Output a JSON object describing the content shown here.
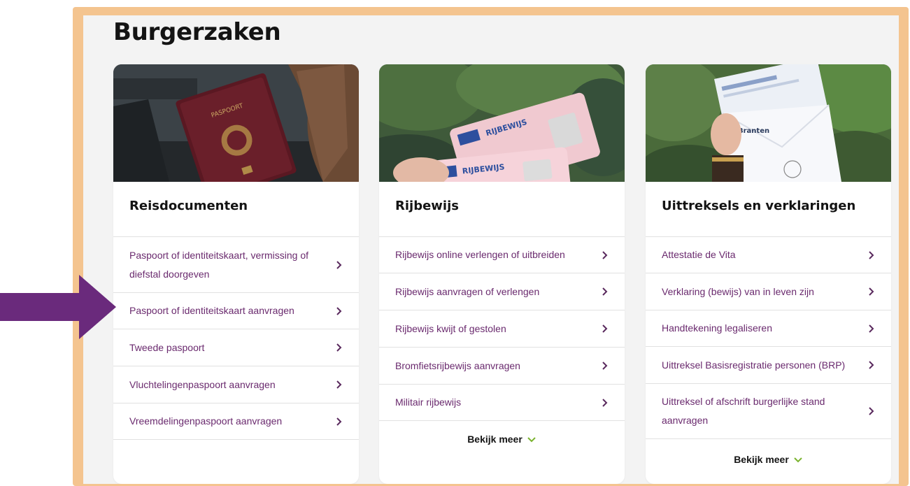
{
  "page": {
    "title": "Burgerzaken"
  },
  "colors": {
    "frame": "#f4c48f",
    "link": "#6a2a6e",
    "chevron": "#5a2a5e",
    "accent_green": "#7ab32e",
    "arrow": "#6a2a7c"
  },
  "cards": [
    {
      "title": "Reisdocumenten",
      "items": [
        "Paspoort of identiteitskaart, vermissing of diefstal doorgeven",
        "Paspoort of identiteitskaart aanvragen",
        "Tweede paspoort",
        "Vluchtelingenpaspoort aanvragen",
        "Vreemdelingenpaspoort aanvragen"
      ]
    },
    {
      "title": "Rijbewijs",
      "items": [
        "Rijbewijs online verlengen of uitbreiden",
        "Rijbewijs aanvragen of verlengen",
        "Rijbewijs kwijt of gestolen",
        "Bromfietsrijbewijs aanvragen",
        "Militair rijbewijs"
      ],
      "more": "Bekijk meer",
      "img_text": [
        "RIJBEWIJS",
        "RIJBEWIJS"
      ]
    },
    {
      "title": "Uittreksels en verklaringen",
      "items": [
        "Attestatie de Vita",
        "Verklaring (bewijs) van in leven zijn",
        "Handtekening legaliseren",
        "Uittreksel Basisregistratie personen (BRP)",
        "Uittreksel of afschrift burgerlijke stand aanvragen"
      ],
      "more": "Bekijk meer",
      "img_text": "Branten"
    }
  ],
  "passport_text": "PASPOORT"
}
